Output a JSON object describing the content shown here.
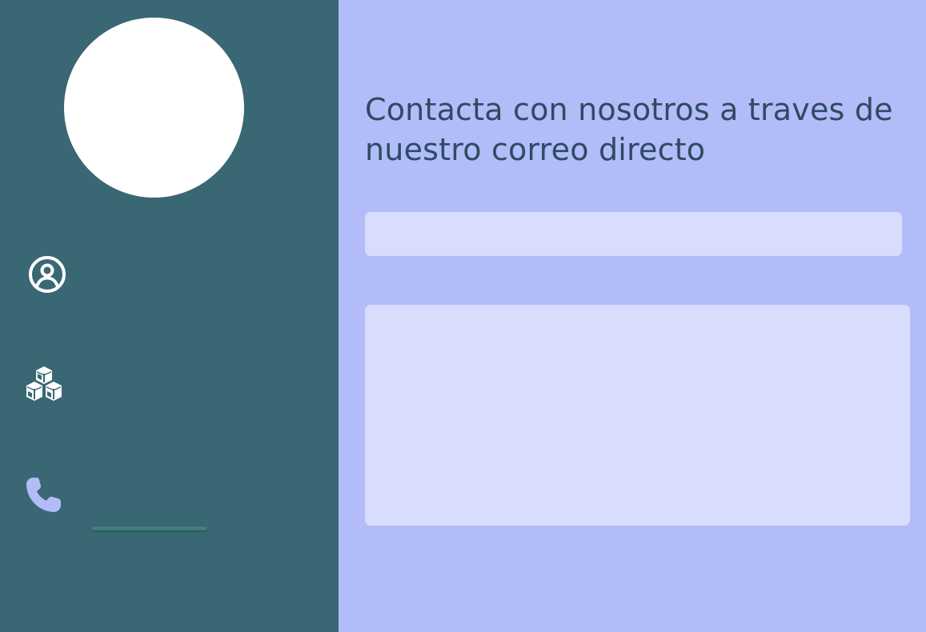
{
  "sidebar": {
    "background": "#396773",
    "avatar": {
      "color": "#ffffff"
    },
    "items": [
      {
        "id": "profile",
        "icon": "user-circle-icon",
        "label": "",
        "active": false
      },
      {
        "id": "products",
        "icon": "cubes-icon",
        "label": "",
        "active": false
      },
      {
        "id": "contact",
        "icon": "phone-icon",
        "label": "",
        "active": true
      }
    ],
    "active_indicator_color": "#3f7f7a",
    "active_icon_color": "#b2bcf9"
  },
  "main": {
    "background": "#b2bcf9",
    "heading": "Contacta con nosotros a traves de nuestro correo directo",
    "email_field": {
      "value": "",
      "placeholder": ""
    },
    "message_field": {
      "value": "",
      "placeholder": ""
    },
    "field_color": "#d8dcfd",
    "text_color": "#2f4a63"
  }
}
